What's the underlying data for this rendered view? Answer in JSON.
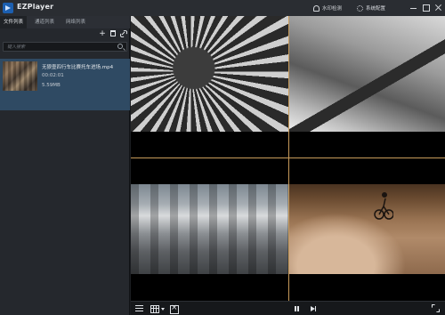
{
  "app": {
    "title": "EZPlayer"
  },
  "titlebar": {
    "watermark_label": "水印检测",
    "settings_label": "系统配置",
    "icons": [
      "watermark-icon",
      "gear-icon",
      "minimize-icon",
      "maximize-icon",
      "close-icon"
    ]
  },
  "sidebar": {
    "tabs": [
      {
        "label": "文件列表",
        "active": true
      },
      {
        "label": "通道列表",
        "active": false
      },
      {
        "label": "网络列表",
        "active": false
      }
    ],
    "toolbar": {
      "add_symbol": "+"
    },
    "search": {
      "placeholder": "键入搜索"
    },
    "files": [
      {
        "name": "无狼壹四行车比赛托车进场.mp4",
        "duration": "00:02:01",
        "size": "5.59MB",
        "selected": true
      }
    ]
  },
  "player": {
    "layout": "2x2",
    "divider_color": "#c89b5a",
    "tiles": [
      {
        "scene": "bicycle-gears-closeup"
      },
      {
        "scene": "cyclist-shadow-road"
      },
      {
        "scene": "city-traffic-street"
      },
      {
        "scene": "mountain-bike-trail"
      }
    ]
  },
  "controls": {
    "icons": [
      "list-toggle-icon",
      "layout-grid-icon",
      "close-all-icon",
      "pause-icon",
      "step-forward-icon",
      "fullscreen-icon"
    ]
  },
  "colors": {
    "accent": "#1c5fb0",
    "selected_row": "#2f4a63",
    "background": "#1b1d21"
  }
}
